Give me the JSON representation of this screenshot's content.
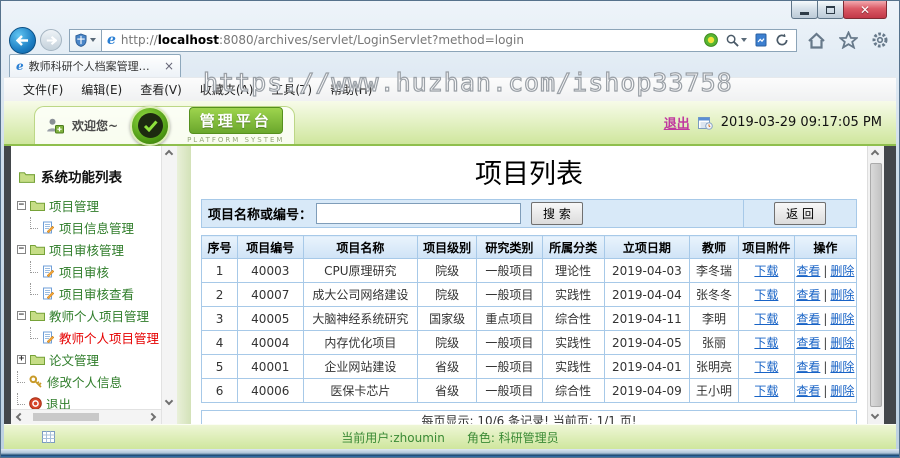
{
  "window": {
    "url_scheme": "http://",
    "url_host": "localhost",
    "url_rest": ":8080/archives/servlet/LoginServlet?method=login",
    "tab_title": "教师科研个人档案管理系统",
    "tab_close": "×",
    "menu_items": [
      "文件(F)",
      "编辑(E)",
      "查看(V)",
      "收藏夹(A)",
      "工具(T)",
      "帮助(H)"
    ],
    "watermark": "https://www.huzhan.com/ishop33758"
  },
  "header": {
    "welcome": "欢迎您~",
    "brand": "管理平台",
    "brand_sub": "PLATFORM SYSTEM",
    "logout": "退出",
    "datetime": "2019-03-29 09:17:05 PM"
  },
  "sidebar": {
    "root": "系统功能列表",
    "groups": [
      {
        "expander": "−",
        "label": "项目管理",
        "children": [
          {
            "label": "项目信息管理"
          }
        ]
      },
      {
        "expander": "−",
        "label": "项目审核管理",
        "children": [
          {
            "label": "项目审核"
          },
          {
            "label": "项目审核查看"
          }
        ]
      },
      {
        "expander": "−",
        "label": "教师个人项目管理",
        "children": [
          {
            "label": "教师个人项目管理"
          }
        ]
      },
      {
        "expander": "+",
        "label": "论文管理",
        "children": []
      }
    ],
    "items": [
      {
        "label": "修改个人信息"
      },
      {
        "label": "退出"
      }
    ]
  },
  "main": {
    "title": "项目列表",
    "search": {
      "label": "项目名称或编号：",
      "input_value": "",
      "button": "搜 索",
      "back_button": "返 回"
    },
    "table": {
      "headers": [
        "序号",
        "项目编号",
        "项目名称",
        "项目级别",
        "研究类别",
        "所属分类",
        "立项日期",
        "教师",
        "项目附件",
        "操作"
      ],
      "download_label": "下载",
      "view_label": "查看",
      "delete_label": "删除",
      "sep": "|",
      "rows": [
        {
          "cells": [
            "1",
            "40003",
            "CPU原理研究",
            "院级",
            "一般项目",
            "理论性",
            "2019-04-03",
            "李冬瑞"
          ]
        },
        {
          "cells": [
            "2",
            "40007",
            "成大公司网络建设",
            "院级",
            "一般项目",
            "实践性",
            "2019-04-04",
            "张冬冬"
          ]
        },
        {
          "cells": [
            "3",
            "40005",
            "大脑神经系统研究",
            "国家级",
            "重点项目",
            "综合性",
            "2019-04-11",
            "李明"
          ]
        },
        {
          "cells": [
            "4",
            "40004",
            "内存优化项目",
            "院级",
            "一般项目",
            "实践性",
            "2019-04-05",
            "张丽"
          ]
        },
        {
          "cells": [
            "5",
            "40001",
            "企业网站建设",
            "省级",
            "一般项目",
            "实践性",
            "2019-04-01",
            "张明亮"
          ]
        },
        {
          "cells": [
            "6",
            "40006",
            "医保卡芯片",
            "省级",
            "一般项目",
            "综合性",
            "2019-04-09",
            "王小明"
          ]
        }
      ]
    },
    "pagination": "每页显示: 10/6 条记录! 当前页: 1/1 页!"
  },
  "footer": {
    "current_user": "当前用户:zhoumin",
    "role": "角色: 科研管理员"
  },
  "colors": {
    "accent_green": "#8fbf4d",
    "table_border_blue": "#a7c9e8",
    "link_blue": "#1863c6",
    "active_item_red": "#e60000",
    "logout_magenta": "#c0399f"
  }
}
